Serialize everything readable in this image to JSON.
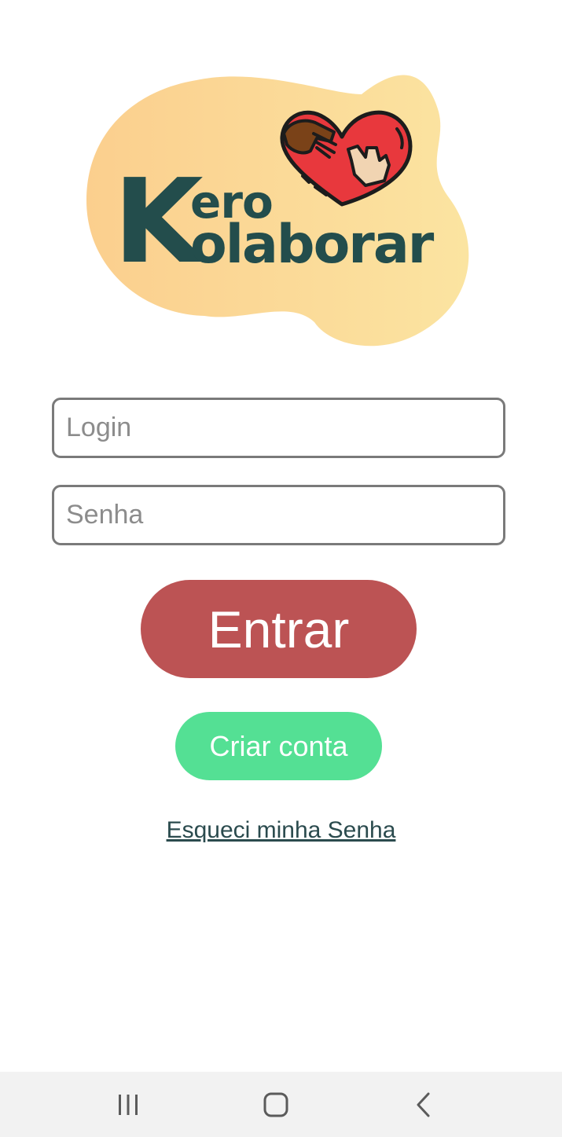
{
  "logo": {
    "line1": "ero",
    "big_letter": "K",
    "line2": "olaborar",
    "colors": {
      "blob_left": "#fbd18f",
      "blob_right": "#fbe3a0",
      "text": "#234d4c",
      "heart": "#e8383d"
    }
  },
  "form": {
    "login_placeholder": "Login",
    "password_placeholder": "Senha"
  },
  "buttons": {
    "enter_label": "Entrar",
    "create_account_label": "Criar conta",
    "forgot_password_label": "Esqueci minha Senha"
  },
  "colors": {
    "enter_button": "#bc5354",
    "create_button": "#54e094",
    "link": "#2b4b4e"
  },
  "navbar": {
    "icons": [
      "recent-apps-icon",
      "home-icon",
      "back-icon"
    ]
  }
}
